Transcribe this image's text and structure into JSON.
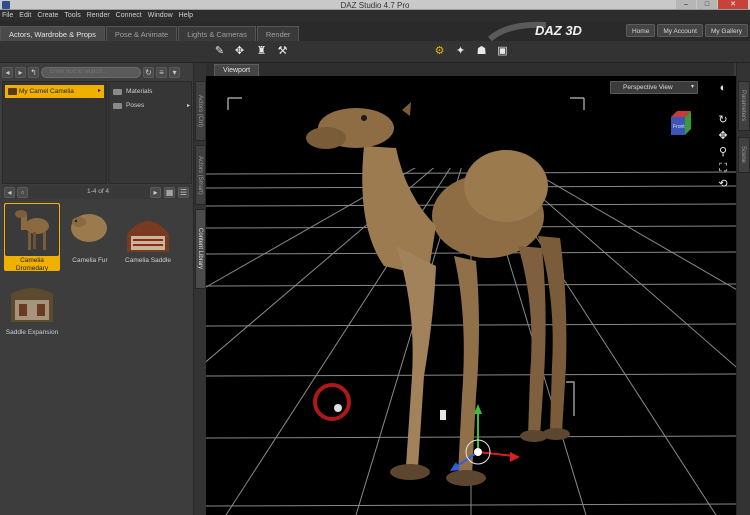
{
  "window": {
    "title": "DAZ Studio 4.7 Pro",
    "controls": [
      "–",
      "□",
      "✕"
    ]
  },
  "menu": [
    "File",
    "Edit",
    "Create",
    "Tools",
    "Render",
    "Connect",
    "Window",
    "Help"
  ],
  "header": {
    "tabs": [
      "Actors, Wardrobe & Props",
      "Pose & Animate",
      "Lights & Cameras",
      "Render"
    ],
    "logo": "DAZ 3D",
    "buttons": [
      "Home",
      "My Account",
      "My Gallery"
    ]
  },
  "left_panel": {
    "search": {
      "placeholder": "Enter text to search..."
    },
    "folder": {
      "label": "My Camel Camelia"
    },
    "subfolders": [
      {
        "label": "Materials"
      },
      {
        "label": "Poses"
      }
    ],
    "page_label": "1-4 of 4",
    "items": [
      {
        "label": "Camelia Dromedary"
      },
      {
        "label": "Camelia Fur"
      },
      {
        "label": "Camelia Saddle"
      },
      {
        "label": "Saddle Expansion"
      }
    ],
    "side_tabs": [
      "Actors (Ctrl)",
      "Actors (Smart)",
      "Content Library"
    ]
  },
  "viewport": {
    "tab": "Viewport",
    "camera": "Perspective View",
    "cube_face": "Front"
  },
  "right_strip_tabs": [
    "Parameters",
    "Scene"
  ],
  "colors": {
    "selection": "#f0b000",
    "background": "#3c3c3c",
    "viewport": "#000000"
  }
}
